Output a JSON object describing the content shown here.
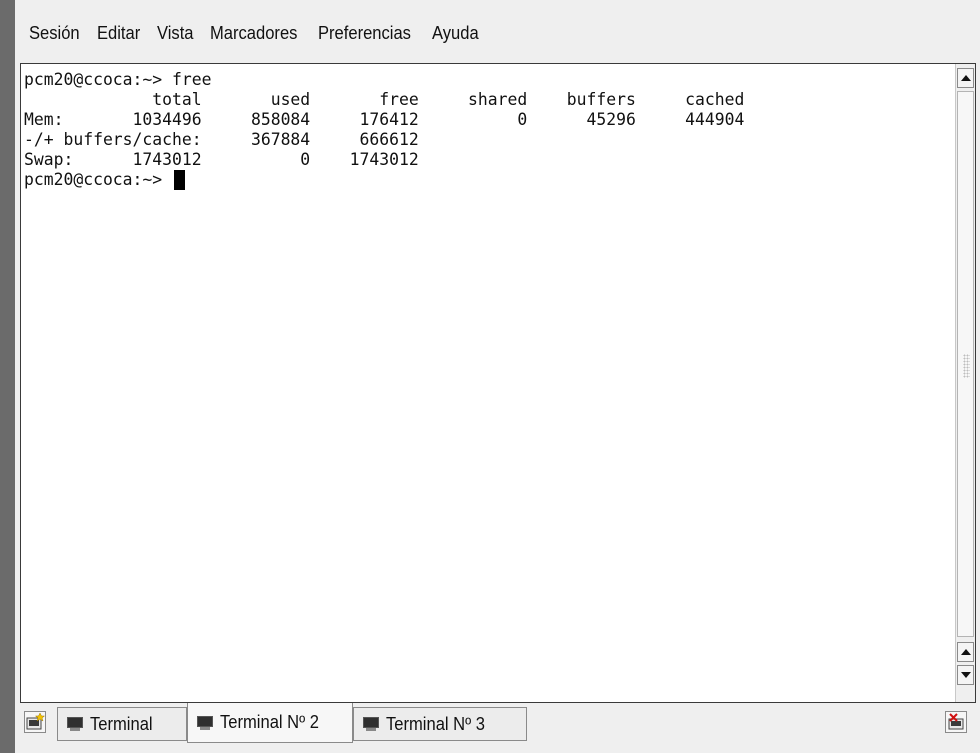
{
  "menubar": {
    "items": [
      "Sesión",
      "Editar",
      "Vista",
      "Marcadores",
      "Preferencias",
      "Ayuda"
    ]
  },
  "terminal": {
    "lines": [
      "pcm20@ccoca:~> free",
      "             total       used       free     shared    buffers     cached",
      "Mem:       1034496     858084     176412          0      45296     444904",
      "-/+ buffers/cache:     367884     666612",
      "Swap:      1743012          0    1743012"
    ],
    "prompt": "pcm20@ccoca:~> "
  },
  "tabs": [
    {
      "label": "Terminal",
      "active": false
    },
    {
      "label": "Terminal Nº 2",
      "active": true
    },
    {
      "label": "Terminal Nº 3",
      "active": false
    }
  ],
  "icons": {
    "new_session": "new-session-icon",
    "close_session": "close-session-icon",
    "tab": "terminal-icon"
  },
  "colors": {
    "terminal_bg": "#ffffff",
    "terminal_fg": "#111111",
    "chrome_bg": "#efefef"
  }
}
